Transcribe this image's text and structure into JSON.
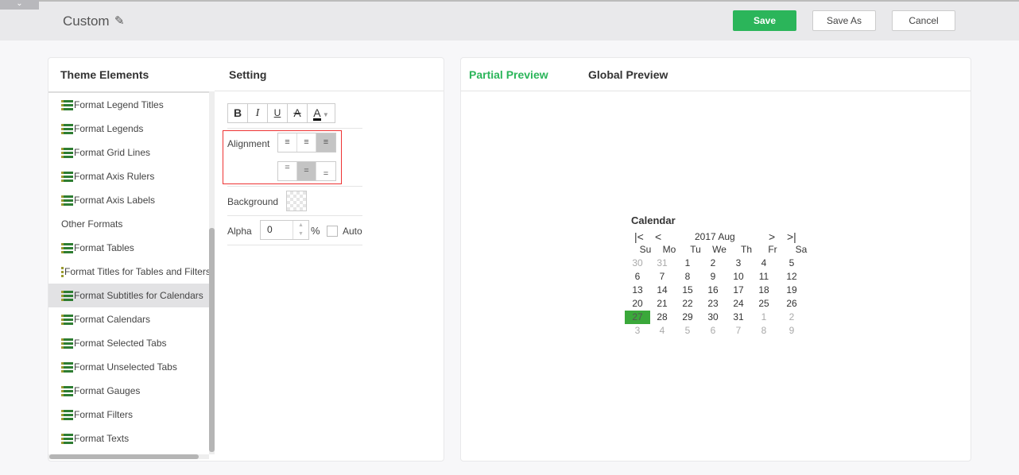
{
  "header": {
    "title": "Custom",
    "edit_icon": "pencil-icon",
    "save": "Save",
    "save_as": "Save As",
    "cancel": "Cancel",
    "accent": "#2bb55a"
  },
  "left": {
    "col1": "Theme Elements",
    "col2": "Setting",
    "items": [
      {
        "label": "Format Legend Titles",
        "icon": true
      },
      {
        "label": "Format Legends",
        "icon": true
      },
      {
        "label": "Format Grid Lines",
        "icon": true
      },
      {
        "label": "Format Axis Rulers",
        "icon": true
      },
      {
        "label": "Format Axis Labels",
        "icon": true
      },
      {
        "label": "Other Formats",
        "icon": false
      },
      {
        "label": "Format Tables",
        "icon": true
      },
      {
        "label": "Format Titles for Tables and Filters",
        "icon": true
      },
      {
        "label": "Format Subtitles for Calendars",
        "icon": true,
        "selected": true
      },
      {
        "label": "Format Calendars",
        "icon": true
      },
      {
        "label": "Format Selected Tabs",
        "icon": true
      },
      {
        "label": "Format Unselected Tabs",
        "icon": true
      },
      {
        "label": "Format Gauges",
        "icon": true
      },
      {
        "label": "Format Filters",
        "icon": true
      },
      {
        "label": "Format Texts",
        "icon": true
      }
    ]
  },
  "setting": {
    "bold": "B",
    "italic": "I",
    "underline": "U",
    "strike": "A",
    "color": "A",
    "alignment": "Alignment",
    "h_align_selected": "right",
    "v_align_selected": "middle",
    "background": "Background",
    "alpha": "Alpha",
    "alpha_value": "0",
    "percent": "%",
    "auto": "Auto",
    "auto_checked": false
  },
  "preview": {
    "tab_partial": "Partial Preview",
    "tab_global": "Global Preview",
    "active": "partial",
    "calendar": {
      "title": "Calendar",
      "month": "2017 Aug",
      "days": [
        "Su",
        "Mo",
        "Tu",
        "We",
        "Th",
        "Fr",
        "Sa"
      ],
      "weeks": [
        [
          "30",
          "31",
          "1",
          "2",
          "3",
          "4",
          "5"
        ],
        [
          "6",
          "7",
          "8",
          "9",
          "10",
          "11",
          "12"
        ],
        [
          "13",
          "14",
          "15",
          "16",
          "17",
          "18",
          "19"
        ],
        [
          "20",
          "21",
          "22",
          "23",
          "24",
          "25",
          "26"
        ],
        [
          "27",
          "28",
          "29",
          "30",
          "31",
          "1",
          "2"
        ],
        [
          "3",
          "4",
          "5",
          "6",
          "7",
          "8",
          "9"
        ]
      ],
      "selected": "27"
    }
  }
}
